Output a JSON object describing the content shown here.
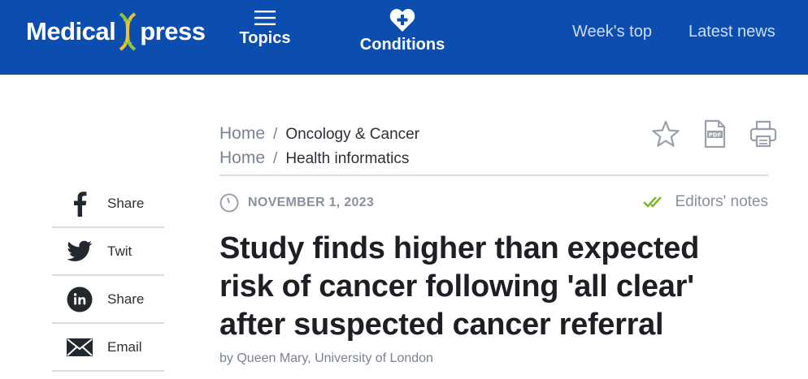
{
  "header": {
    "logo_left": "Medical",
    "logo_right": "press",
    "topics_label": "Topics",
    "conditions_label": "Conditions",
    "weeks_top_label": "Week's top",
    "latest_news_label": "Latest news"
  },
  "breadcrumbs": [
    {
      "home": "Home",
      "separator": "/",
      "category": "Oncology & Cancer"
    },
    {
      "home": "Home",
      "separator": "/",
      "category": "Health informatics"
    }
  ],
  "tools": {
    "icons": [
      "star-icon",
      "pdf-icon",
      "print-icon"
    ]
  },
  "article": {
    "date": "NOVEMBER 1, 2023",
    "editors_notes": "Editors' notes",
    "title": "Study finds higher than expected risk of cancer following 'all clear' after suspected cancer referral",
    "byline": "by Queen Mary, University of London"
  },
  "share": [
    {
      "icon": "facebook-icon",
      "label": "Share"
    },
    {
      "icon": "twitter-icon",
      "label": "Twit"
    },
    {
      "icon": "linkedin-icon",
      "label": "Share"
    },
    {
      "icon": "email-icon",
      "label": "Email"
    }
  ],
  "colors": {
    "header_bg": "#0b4eb0",
    "dna_green": "#8dc63f",
    "check_green": "#7bb026",
    "muted_text": "#8a909c"
  }
}
